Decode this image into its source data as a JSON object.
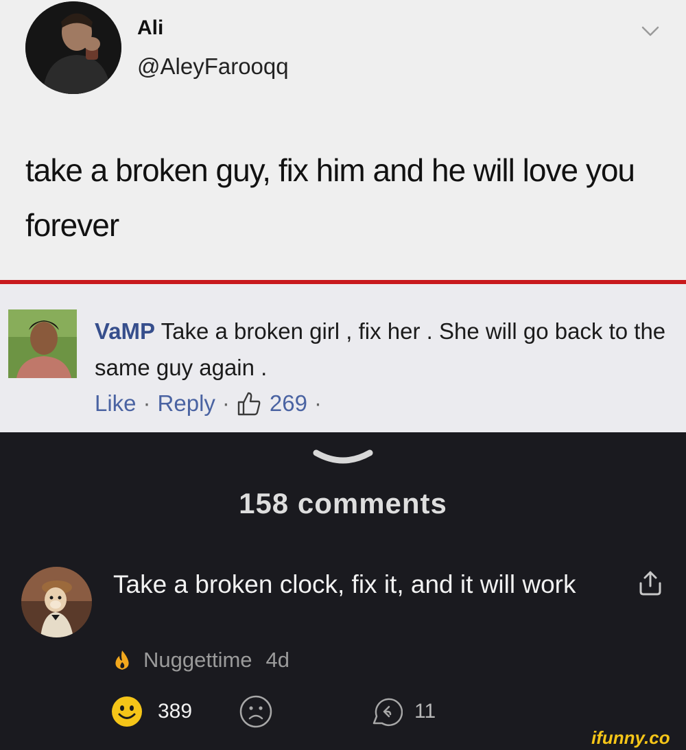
{
  "tweet": {
    "author_name": "Ali",
    "author_handle": "@AleyFarooqq",
    "text": "take a broken guy, fix him and he will love you forever"
  },
  "fb_comment": {
    "author": "VaMP",
    "text": " Take a broken girl , fix her . She will go back to the same guy again .",
    "like_label": "Like",
    "reply_label": "Reply",
    "separator": "·",
    "like_count": "269"
  },
  "comments_section": {
    "count_label": "158 comments",
    "comment": {
      "text": "Take a broken clock, fix it, and it will work",
      "username": "Nuggettime",
      "time": "4d",
      "smile_count": "389",
      "reply_count": "11"
    }
  },
  "watermark": "ifunny.co",
  "colors": {
    "accent_red": "#c8191d",
    "fb_link_blue": "#4a63a2",
    "fb_author_blue": "#364e8c",
    "smile_yellow": "#f5c518",
    "flame_orange": "#f2a81d"
  },
  "icons": [
    "chevron-down-icon",
    "thumbs-up-icon",
    "drag-handle-icon",
    "share-icon",
    "flame-icon",
    "smile-icon",
    "frown-icon",
    "reply-icon"
  ]
}
